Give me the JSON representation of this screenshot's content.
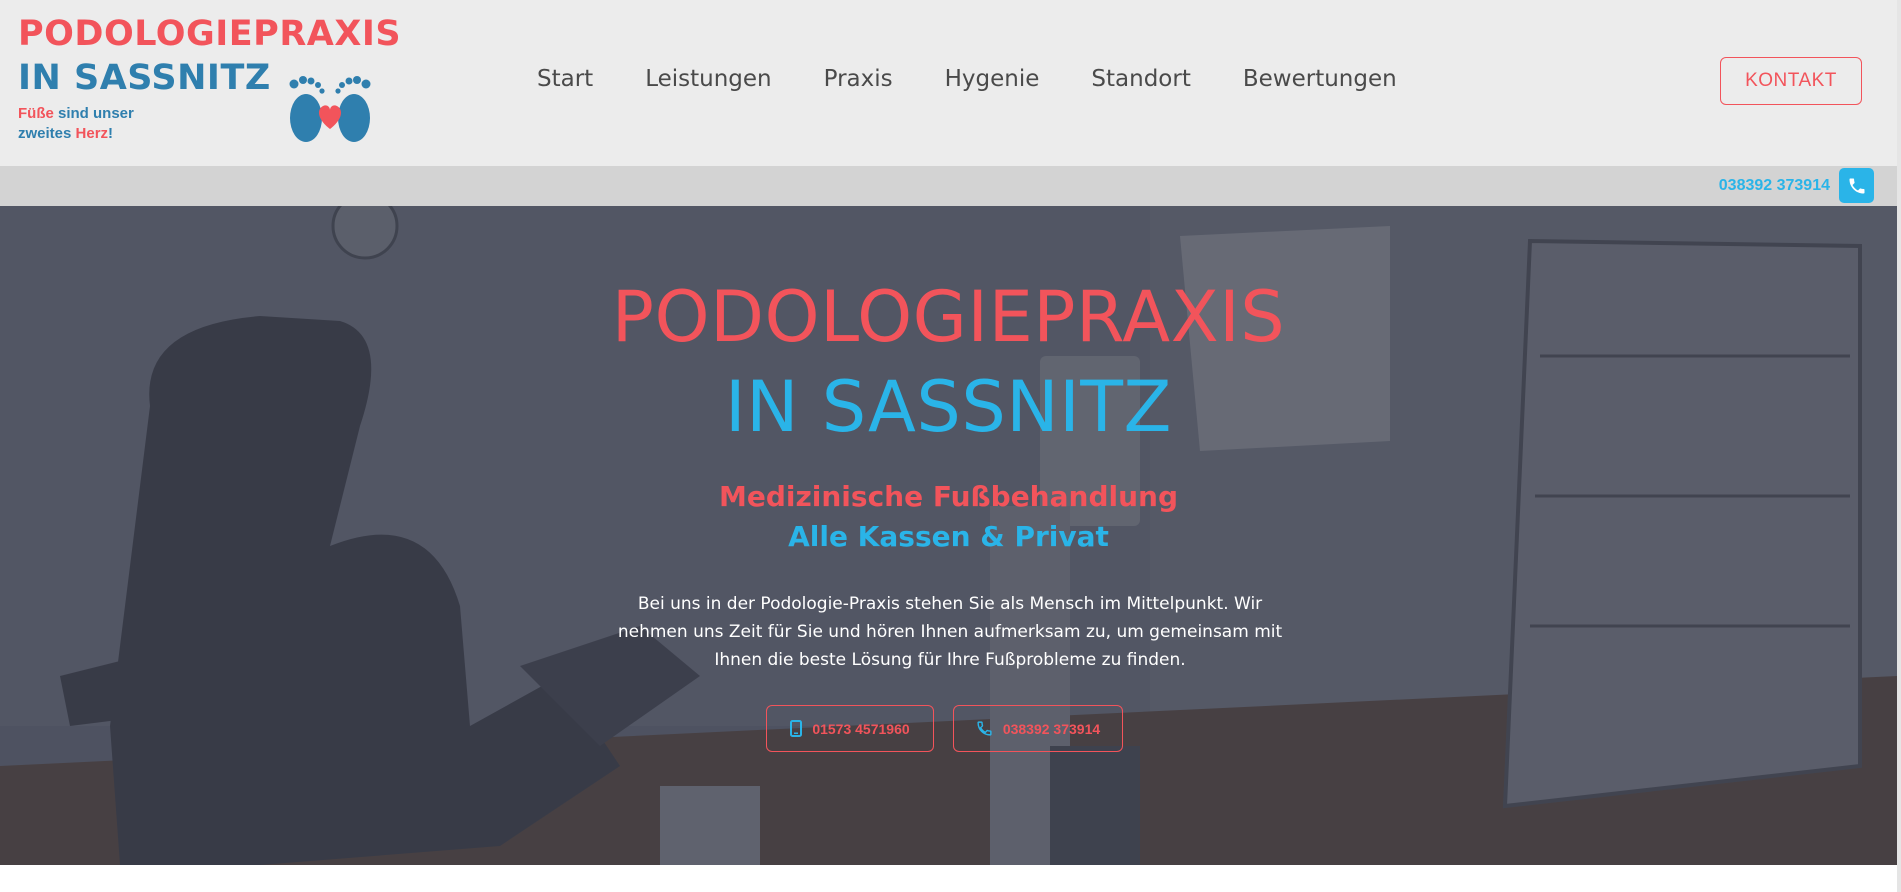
{
  "header": {
    "logo": {
      "line1": "PODOLOGIEPRAXIS",
      "line2": "IN SASSNITZ",
      "tagline": {
        "w1": "Füße",
        "w2": " sind unser",
        "w3": "zweites ",
        "w4": "Herz",
        "w5": "!"
      }
    },
    "nav": [
      "Start",
      "Leistungen",
      "Praxis",
      "Hygenie",
      "Standort",
      "Bewertungen"
    ],
    "cta_label": "KONTAKT"
  },
  "topbar": {
    "phone": "038392 373914",
    "phone_icon": "phone-icon"
  },
  "hero": {
    "title_line1": "PODOLOGIEPRAXIS",
    "title_line2": "IN SASSNITZ",
    "subtitle1": "Medizinische Fußbehandlung",
    "subtitle2": "Alle Kassen & Privat",
    "text": "Bei uns in der Podologie-Praxis stehen Sie als Mensch im Mittelpunkt. Wir nehmen uns Zeit für Sie und hören Ihnen aufmerksam zu, um gemeinsam mit Ihnen die beste Lösung für Ihre Fußprobleme zu finden.",
    "buttons": [
      {
        "label": "01573 4571960",
        "icon": "mobile-icon"
      },
      {
        "label": "038392 373914",
        "icon": "phone-icon"
      }
    ]
  },
  "colors": {
    "brand_red": "#f2545b",
    "brand_blue": "#2ab4e8",
    "logo_blue": "#2f7fae",
    "header_bg": "#ececec",
    "topbar_bg": "#d3d3d3"
  }
}
